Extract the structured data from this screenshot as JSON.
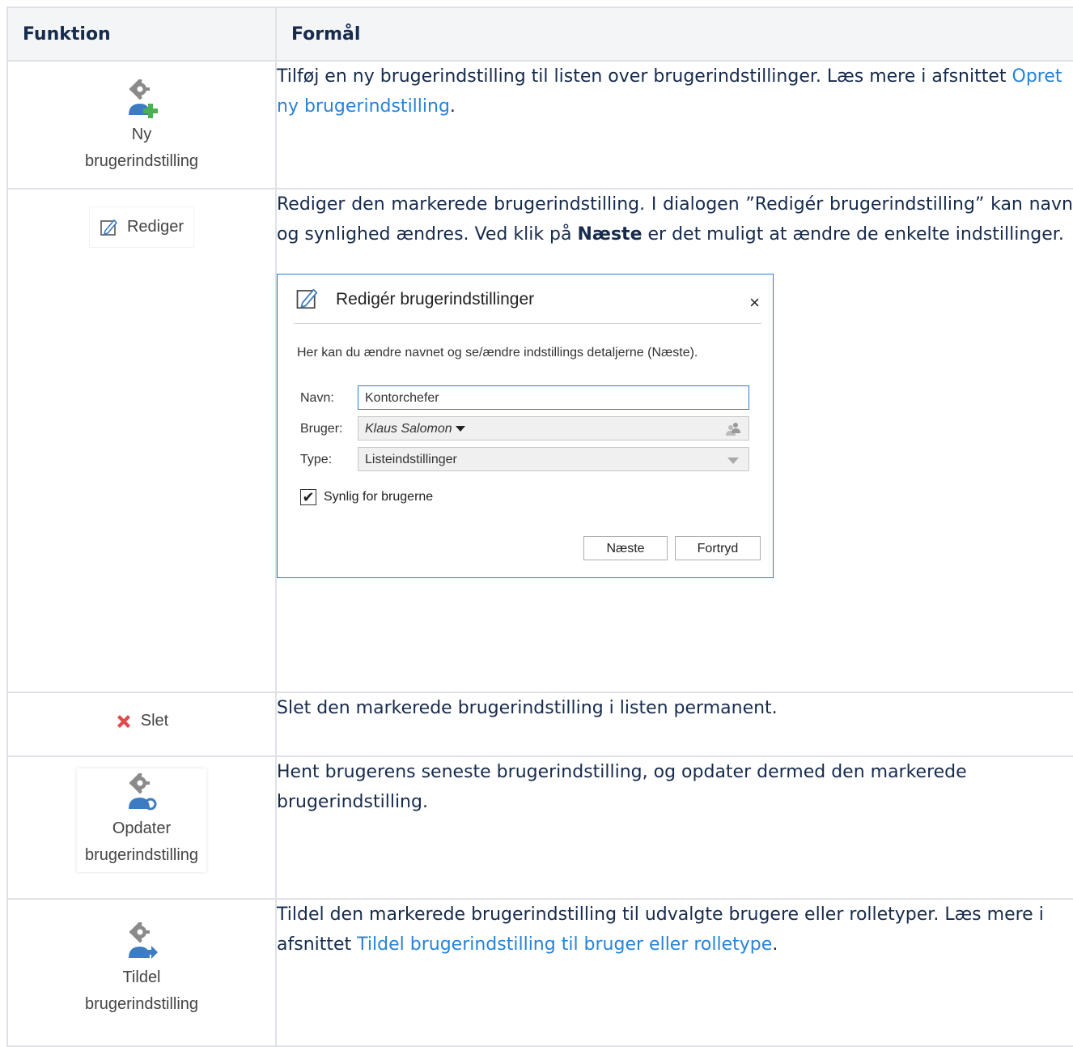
{
  "header": {
    "col_function": "Funktion",
    "col_purpose": "Formål"
  },
  "rows": {
    "ny": {
      "button_line1": "Ny",
      "button_line2": "brugerindstilling",
      "desc_text": "Tilføj en ny brugerindstilling til listen over brugerindstillinger. Læs mere i afsnittet ",
      "desc_link": "Opret ny brugerindstilling",
      "desc_end": "."
    },
    "rediger": {
      "button_label": "Rediger",
      "desc_text": "Rediger den markerede brugerindstilling. I dialogen ”Redigér brugerindstilling” kan navn og synlighed ændres. Ved klik på ",
      "desc_bold": "Næste",
      "desc_end": " er det muligt at ændre de enkelte indstillinger."
    },
    "slet": {
      "button_label": "Slet",
      "desc_text": "Slet den markerede brugerindstilling i listen permanent."
    },
    "opdater": {
      "button_line1": "Opdater",
      "button_line2": "brugerindstilling",
      "desc_text": "Hent brugerens seneste brugerindstilling, og opdater dermed den markerede brugerindstilling."
    },
    "tildel": {
      "button_line1": "Tildel",
      "button_line2": "brugerindstilling",
      "desc_text": "Tildel den markerede brugerindstilling til udvalgte brugere eller rolletyper. Læs mere i afsnittet ",
      "desc_link": "Tildel brugerindstilling til bruger eller rolletype",
      "desc_end": "."
    }
  },
  "dialog": {
    "title": "Redigér brugerindstillinger",
    "close": "×",
    "intro": "Her kan du ændre navnet og se/ændre indstillings detaljerne (Næste).",
    "name_label": "Navn:",
    "name_value": "Kontorchefer",
    "user_label": "Bruger:",
    "user_value": "Klaus Salomon",
    "type_label": "Type:",
    "type_value": "Listeindstillinger",
    "checkbox_label": "Synlig for brugerne",
    "checkbox_checked": true,
    "next_button": "Næste",
    "cancel_button": "Fortryd"
  },
  "colors": {
    "link": "#2684d9",
    "header_bg": "#f4f5f7",
    "border": "#dfe1e6",
    "icon_blue": "#3d7bc2",
    "icon_green": "#4caf50",
    "delete_red": "#e04a4a"
  }
}
